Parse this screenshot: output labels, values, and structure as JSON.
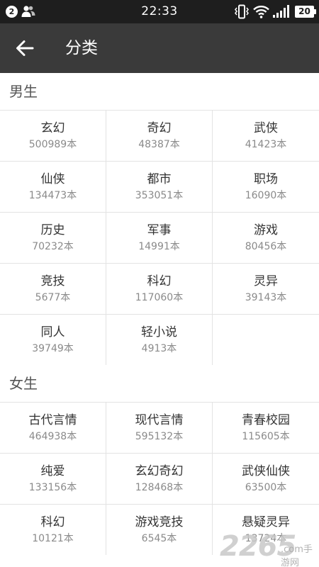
{
  "status_bar": {
    "notification_count": "2",
    "time": "22:33",
    "battery": "20"
  },
  "app_bar": {
    "back_icon": "arrow-left-icon",
    "title": "分类"
  },
  "sections": [
    {
      "header": "男生",
      "items": [
        {
          "name": "玄幻",
          "count": "500989本"
        },
        {
          "name": "奇幻",
          "count": "48387本"
        },
        {
          "name": "武侠",
          "count": "41423本"
        },
        {
          "name": "仙侠",
          "count": "134473本"
        },
        {
          "name": "都市",
          "count": "353051本"
        },
        {
          "name": "职场",
          "count": "16090本"
        },
        {
          "name": "历史",
          "count": "70232本"
        },
        {
          "name": "军事",
          "count": "14991本"
        },
        {
          "name": "游戏",
          "count": "80456本"
        },
        {
          "name": "竞技",
          "count": "5677本"
        },
        {
          "name": "科幻",
          "count": "117060本"
        },
        {
          "name": "灵异",
          "count": "39143本"
        },
        {
          "name": "同人",
          "count": "39749本"
        },
        {
          "name": "轻小说",
          "count": "4913本"
        }
      ]
    },
    {
      "header": "女生",
      "items": [
        {
          "name": "古代言情",
          "count": "464938本"
        },
        {
          "name": "现代言情",
          "count": "595132本"
        },
        {
          "name": "青春校园",
          "count": "115605本"
        },
        {
          "name": "纯爱",
          "count": "133156本"
        },
        {
          "name": "玄幻奇幻",
          "count": "128468本"
        },
        {
          "name": "武侠仙侠",
          "count": "63500本"
        },
        {
          "name": "科幻",
          "count": "10121本"
        },
        {
          "name": "游戏竞技",
          "count": "6545本"
        },
        {
          "name": "悬疑灵异",
          "count": "13724本"
        }
      ]
    }
  ],
  "watermark": {
    "logo_number": "2265",
    "logo_text": ".com手游网"
  }
}
